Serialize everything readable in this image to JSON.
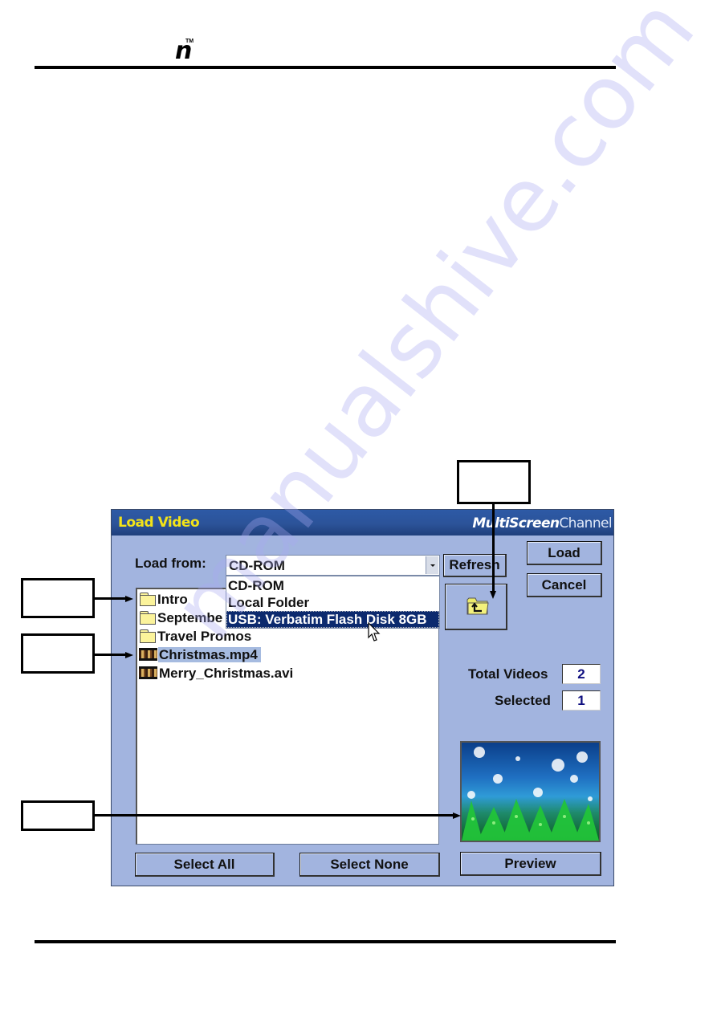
{
  "page": {
    "header_logo": "n",
    "header_trademark": "TM",
    "watermark": "manualshive.com"
  },
  "dialog": {
    "title": "Load Video",
    "brand": {
      "bold": "MultiScreen",
      "light": "Channel"
    },
    "load_from_label": "Load from:",
    "load_from_value": "CD-ROM",
    "dropdown_options": [
      {
        "label": "CD-ROM",
        "highlighted": false
      },
      {
        "label": "Local Folder",
        "highlighted": false
      },
      {
        "label": "USB: Verbatim Flash Disk 8GB",
        "highlighted": true
      }
    ],
    "buttons": {
      "refresh": "Refresh",
      "load": "Load",
      "cancel": "Cancel",
      "select_all": "Select All",
      "select_none": "Select None",
      "preview": "Preview"
    },
    "files": [
      {
        "name": "Intro",
        "type": "folder",
        "selected": false
      },
      {
        "name": "Septembe",
        "type": "folder",
        "selected": false
      },
      {
        "name": "Travel Promos",
        "type": "folder",
        "selected": false
      },
      {
        "name": "Christmas.mp4",
        "type": "video",
        "selected": true
      },
      {
        "name": "Merry_Christmas.avi",
        "type": "video",
        "selected": false
      }
    ],
    "total_videos_label": "Total Videos",
    "total_videos_value": "2",
    "selected_label": "Selected",
    "selected_value": "1",
    "preview_image": "christmas-snowflakes-trees-thumbnail",
    "up_folder_icon": "folder-up-icon"
  },
  "colors": {
    "dialog_bg": "#a2b4df",
    "titlebar": "#2c5399",
    "title_text": "#f3e318",
    "selection_highlight": "#0c2a6e",
    "list_selection": "#a6bbe0",
    "count_text": "#101080"
  }
}
